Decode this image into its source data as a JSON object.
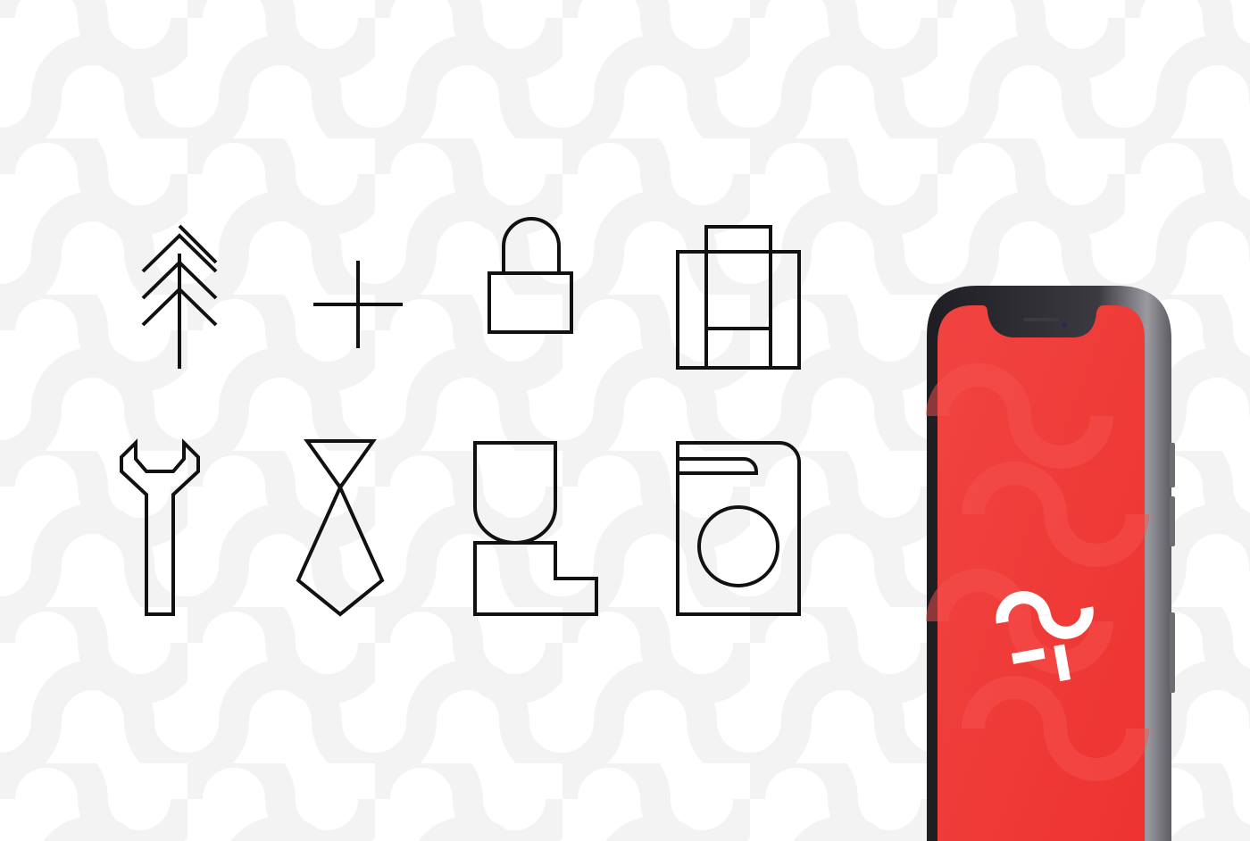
{
  "colors": {
    "background": "#ffffff",
    "pattern": "#f3f3f3",
    "icon_stroke": "#111111",
    "phone_screen": "#f03a37",
    "phone_frame": "#2b2b30",
    "logo": "#ffffff"
  },
  "icons": [
    {
      "name": "tree-icon"
    },
    {
      "name": "plus-icon"
    },
    {
      "name": "padlock-icon"
    },
    {
      "name": "building-icon"
    },
    {
      "name": "wrench-icon"
    },
    {
      "name": "tie-icon"
    },
    {
      "name": "boot-icon"
    },
    {
      "name": "washing-machine-icon"
    }
  ],
  "phone": {
    "device": "smartphone",
    "logo": "brand-logo-icon"
  }
}
